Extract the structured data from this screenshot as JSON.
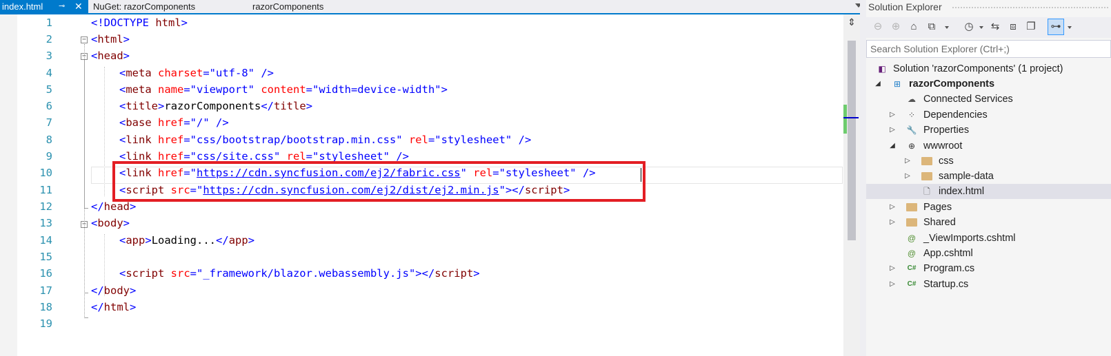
{
  "tabs": {
    "active": {
      "label": "index.html",
      "pin_icon": "pin-icon",
      "close_icon": "close-icon"
    },
    "nuget": {
      "label": "NuGet: razorComponents",
      "project": "razorComponents"
    },
    "dropdown_icon": "chevron-down-icon"
  },
  "editor": {
    "line_numbers": [
      "1",
      "2",
      "3",
      "4",
      "5",
      "6",
      "7",
      "8",
      "9",
      "10",
      "11",
      "12",
      "13",
      "14",
      "15",
      "16",
      "17",
      "18",
      "19"
    ],
    "lines": {
      "l1": {
        "a": "<!DOCTYPE ",
        "b": "html",
        "c": ">"
      },
      "l2": {
        "a": "<",
        "b": "html",
        "c": ">"
      },
      "l3": {
        "a": "<",
        "b": "head",
        "c": ">"
      },
      "l4": {
        "a": "<",
        "tag": "meta",
        "attr": " charset",
        "eq": "=",
        "val": "\"utf-8\"",
        "end": " />"
      },
      "l5": {
        "a": "<",
        "tag": "meta",
        "attr1": " name",
        "val1": "=\"viewport\"",
        "attr2": " content",
        "val2": "=\"width=device-width\"",
        "end": ">"
      },
      "l6": {
        "a": "<",
        "tag": "title",
        "c": ">",
        "txt": "razorComponents",
        "d": "</",
        "tag2": "title",
        "e": ">"
      },
      "l7": {
        "a": "<",
        "tag": "base",
        "attr": " href",
        "val": "=\"/\"",
        "end": " />"
      },
      "l8": {
        "a": "<",
        "tag": "link",
        "attr1": " href",
        "val1": "=\"css/bootstrap/bootstrap.min.css\"",
        "attr2": " rel",
        "val2": "=\"stylesheet\"",
        "end": " />"
      },
      "l9": {
        "a": "<",
        "tag": "link",
        "attr1": " href",
        "val1": "=\"css/site.css\"",
        "attr2": " rel",
        "val2": "=\"stylesheet\"",
        "end": " />"
      },
      "l10": {
        "a": "<",
        "tag": "link",
        "attr1": " href",
        "q1": "=\"",
        "url": "https://cdn.syncfusion.com/ej2/fabric.css",
        "q2": "\"",
        "attr2": " rel",
        "val2": "=\"stylesheet\"",
        "end": " />"
      },
      "l11": {
        "a": "<",
        "tag": "script",
        "attr1": " src",
        "q1": "=\"",
        "url": "https://cdn.syncfusion.com/ej2/dist/ej2.min.js",
        "q2": "\"",
        "c": "></",
        "tag2": "script",
        "e": ">"
      },
      "l12": {
        "a": "</",
        "b": "head",
        "c": ">"
      },
      "l13": {
        "a": "<",
        "b": "body",
        "c": ">"
      },
      "l14": {
        "a": "<",
        "tag": "app",
        "c": ">",
        "txt": "Loading...",
        "d": "</",
        "tag2": "app",
        "e": ">"
      },
      "l16": {
        "a": "<",
        "tag": "script",
        "attr1": " src",
        "val1": "=\"_framework/blazor.webassembly.js\"",
        "c": "></",
        "tag2": "script",
        "e": ">"
      },
      "l17": {
        "a": "</",
        "b": "body",
        "c": ">"
      },
      "l18": {
        "a": "</",
        "b": "html",
        "c": ">"
      }
    },
    "fold_glyph": "−"
  },
  "solution_explorer": {
    "title": "Solution Explorer",
    "search_placeholder": "Search Solution Explorer (Ctrl+;)",
    "toolbar_icons": [
      "back-icon",
      "forward-icon",
      "home-icon",
      "switch-views-icon",
      "pending-changes-icon",
      "sync-icon",
      "collapse-all-icon",
      "show-all-files-icon",
      "properties-icon"
    ],
    "tree": [
      {
        "label": "Solution 'razorComponents' (1 project)",
        "icon": "vs-solution-icon"
      },
      {
        "label": "razorComponents",
        "icon": "web-project-icon"
      },
      {
        "label": "Connected Services",
        "icon": "cloud-icon"
      },
      {
        "label": "Dependencies",
        "icon": "dependencies-icon"
      },
      {
        "label": "Properties",
        "icon": "wrench-icon"
      },
      {
        "label": "wwwroot",
        "icon": "globe-icon"
      },
      {
        "label": "css",
        "icon": "folder-icon"
      },
      {
        "label": "sample-data",
        "icon": "folder-icon"
      },
      {
        "label": "index.html",
        "icon": "html-file-icon"
      },
      {
        "label": "Pages",
        "icon": "folder-icon"
      },
      {
        "label": "Shared",
        "icon": "folder-icon"
      },
      {
        "label": "_ViewImports.cshtml",
        "icon": "razor-file-icon"
      },
      {
        "label": "App.cshtml",
        "icon": "razor-file-icon"
      },
      {
        "label": "Program.cs",
        "icon": "csharp-file-icon"
      },
      {
        "label": "Startup.cs",
        "icon": "csharp-file-icon"
      }
    ]
  },
  "colors": {
    "accent": "#007acc",
    "highlight": "#e31e24",
    "tag": "#800000",
    "attribute": "#ff0000",
    "value": "#0000ff",
    "line_number": "#2b91af"
  }
}
